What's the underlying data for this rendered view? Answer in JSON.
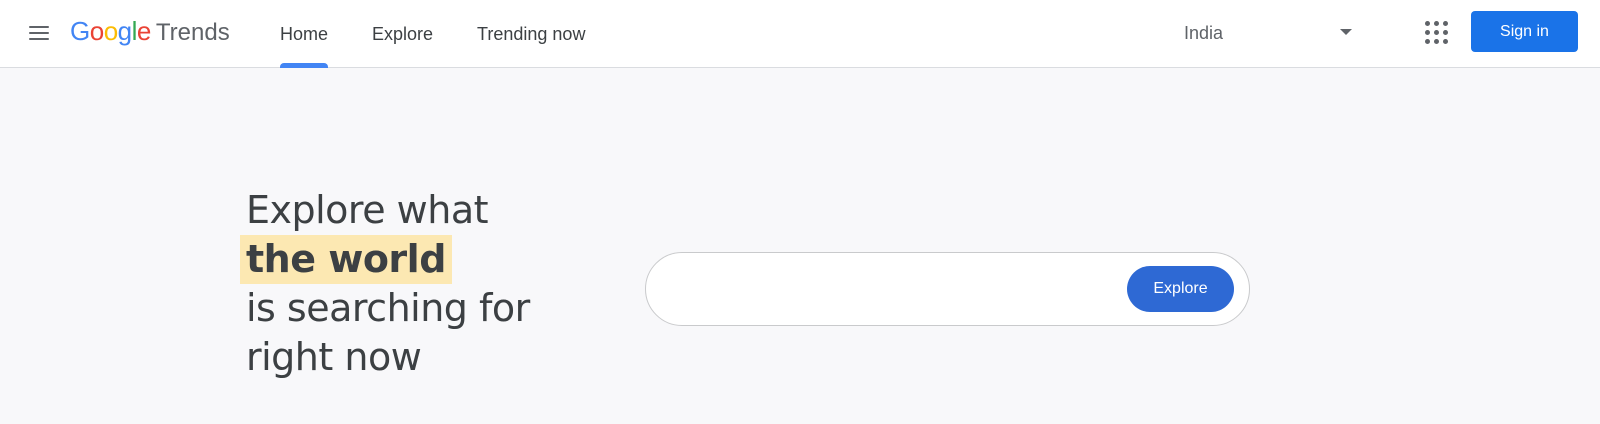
{
  "header": {
    "menu_icon": "hamburger-menu-icon",
    "logo": {
      "letters": [
        {
          "char": "G",
          "color": "#4285f4"
        },
        {
          "char": "o",
          "color": "#ea4335"
        },
        {
          "char": "o",
          "color": "#fbbc05"
        },
        {
          "char": "g",
          "color": "#4285f4"
        },
        {
          "char": "l",
          "color": "#34a853"
        },
        {
          "char": "e",
          "color": "#ea4335"
        }
      ],
      "product": "Trends"
    },
    "nav": [
      {
        "label": "Home",
        "active": true
      },
      {
        "label": "Explore",
        "active": false
      },
      {
        "label": "Trending now",
        "active": false
      }
    ],
    "region": {
      "selected": "India"
    },
    "apps_icon": "google-apps-grid-icon",
    "sign_in_label": "Sign in"
  },
  "hero": {
    "line1": "Explore what",
    "highlight": "the world",
    "line3": "is searching for",
    "line4": "right now"
  },
  "search": {
    "value": "",
    "button_label": "Explore"
  },
  "colors": {
    "accent": "#1a73e8",
    "explore_button": "#2e69d4",
    "tab_indicator": "#4285f4",
    "highlight": "#fce8b2"
  }
}
